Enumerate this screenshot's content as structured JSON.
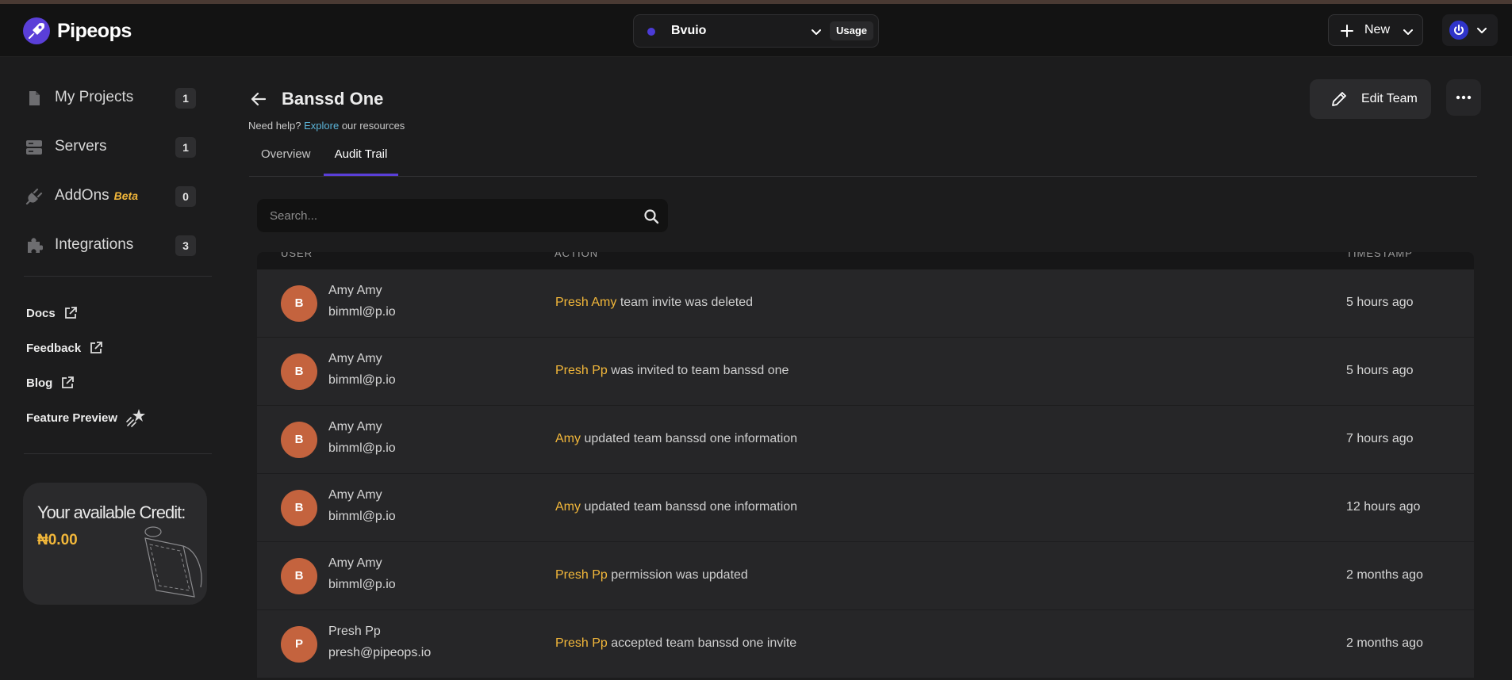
{
  "app": {
    "name": "Pipeops"
  },
  "header": {
    "project_name": "Bvuio",
    "usage_label": "Usage",
    "new_label": "New"
  },
  "sidebar": {
    "nav": [
      {
        "label": "My Projects",
        "count": "1"
      },
      {
        "label": "Servers",
        "count": "1"
      },
      {
        "label": "AddOns",
        "tag": "Beta",
        "count": "0"
      },
      {
        "label": "Integrations",
        "count": "3"
      }
    ],
    "links": [
      {
        "label": "Docs"
      },
      {
        "label": "Feedback"
      },
      {
        "label": "Blog"
      },
      {
        "label": "Feature Preview"
      }
    ],
    "credit": {
      "title": "Your available Credit:",
      "value": "₦0.00"
    }
  },
  "page": {
    "title": "Banssd One",
    "help_prefix": "Need help?",
    "help_link": "Explore",
    "help_suffix": "our resources",
    "edit_label": "Edit Team",
    "tabs": [
      {
        "label": "Overview",
        "active": false
      },
      {
        "label": "Audit Trail",
        "active": true
      }
    ],
    "search_placeholder": "Search..."
  },
  "table": {
    "columns": [
      "USER",
      "ACTION",
      "TIMESTAMP"
    ],
    "rows": [
      {
        "initial": "B",
        "name": "Amy Amy",
        "email": "bimml@p.io",
        "actor": "Presh Amy",
        "action": "team invite was deleted",
        "timestamp": "5 hours ago"
      },
      {
        "initial": "B",
        "name": "Amy Amy",
        "email": "bimml@p.io",
        "actor": "Presh Pp",
        "action": "was invited to team banssd one",
        "timestamp": "5 hours ago"
      },
      {
        "initial": "B",
        "name": "Amy Amy",
        "email": "bimml@p.io",
        "actor": "Amy",
        "action": "updated team banssd one information",
        "timestamp": "7 hours ago"
      },
      {
        "initial": "B",
        "name": "Amy Amy",
        "email": "bimml@p.io",
        "actor": "Amy",
        "action": "updated team banssd one information",
        "timestamp": "12 hours ago"
      },
      {
        "initial": "B",
        "name": "Amy Amy",
        "email": "bimml@p.io",
        "actor": "Presh Pp",
        "action": "permission was updated",
        "timestamp": "2 months ago"
      },
      {
        "initial": "P",
        "name": "Presh Pp",
        "email": "presh@pipeops.io",
        "actor": "Presh Pp",
        "action": "accepted team banssd one invite",
        "timestamp": "2 months ago"
      }
    ]
  },
  "colors": {
    "accent": "#5a3fd8",
    "actor_highlight": "#f2b73a",
    "avatar_bg": "#c4633e",
    "link": "#5bb5d9"
  }
}
